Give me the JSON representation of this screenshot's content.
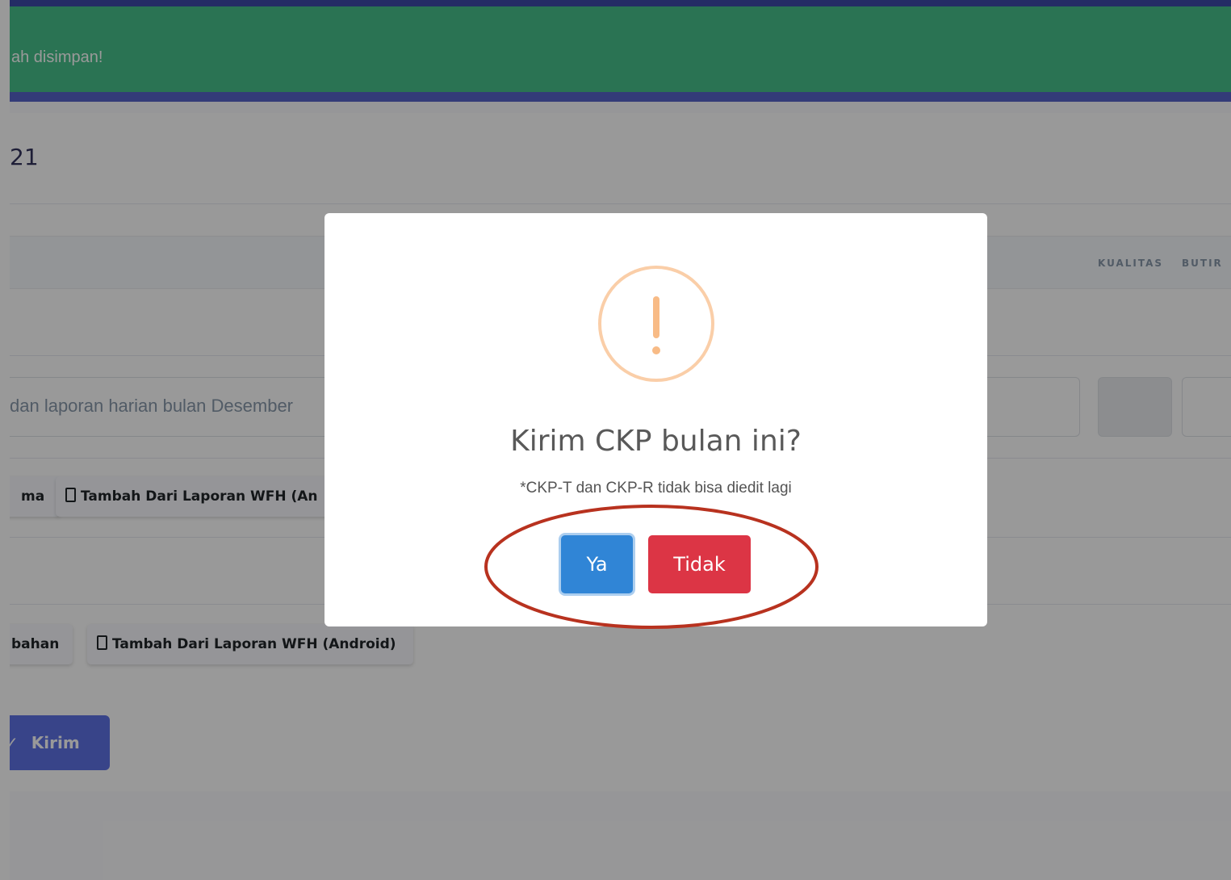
{
  "alert": {
    "message": "ah disimpan!"
  },
  "card": {
    "title": "21"
  },
  "table": {
    "headers": [
      "KUALITAS",
      "BUTIR"
    ]
  },
  "row1": {
    "input_text": "dan laporan harian bulan Desember"
  },
  "actions1": {
    "btn1_label": "ma",
    "btn2_label": "Tambah Dari Laporan WFH (An"
  },
  "actions2": {
    "btn1_label": "bahan",
    "btn2_label": "Tambah Dari Laporan WFH (Android)"
  },
  "submit": {
    "label": "Kirim"
  },
  "dialog": {
    "title": "Kirim CKP bulan ini?",
    "text": "*CKP-T dan CKP-R tidak bisa diedit lagi",
    "confirm_label": "Ya",
    "cancel_label": "Tidak",
    "confirm_color": "#3085d6",
    "cancel_color": "#dc3545"
  },
  "annotation": {
    "color": "#b8321f",
    "shape": "ellipse-highlight"
  },
  "icons": [
    "mobile-phone-icon",
    "warning-icon",
    "check-icon"
  ]
}
